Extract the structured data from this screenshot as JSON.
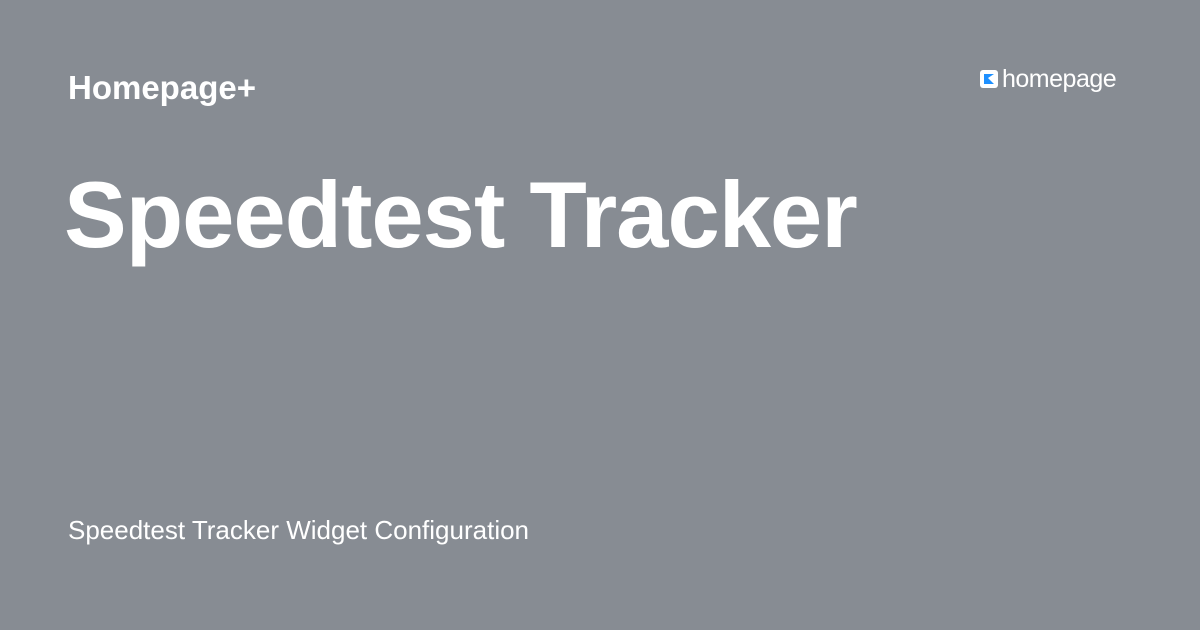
{
  "header": {
    "site_name": "Homepage+"
  },
  "logo": {
    "icon": "homepage-logo-icon",
    "text": "homepage",
    "icon_colors": {
      "tile": "#ffffff",
      "mark": "#1e90ff"
    }
  },
  "main": {
    "title": "Speedtest Tracker",
    "description": "Speedtest Tracker Widget Configuration"
  },
  "colors": {
    "background": "#878c93",
    "text": "#ffffff"
  }
}
